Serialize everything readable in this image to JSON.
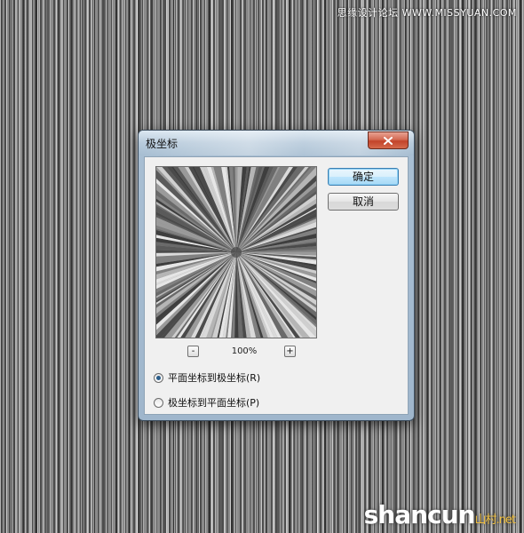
{
  "watermark": {
    "top": "思缘设计论坛 WWW.MISSYUAN.COM",
    "bottom_main": "shancun",
    "bottom_suffix": "山村.net"
  },
  "dialog": {
    "title": "极坐标",
    "buttons": {
      "ok": "确定",
      "cancel": "取消"
    },
    "zoom": {
      "minus": "-",
      "plus": "+",
      "value": "100%"
    },
    "options": [
      {
        "label": "平面坐标到极坐标(R)",
        "selected": true
      },
      {
        "label": "极坐标到平面坐标(P)",
        "selected": false
      }
    ]
  },
  "icons": {
    "close": "close-icon"
  }
}
